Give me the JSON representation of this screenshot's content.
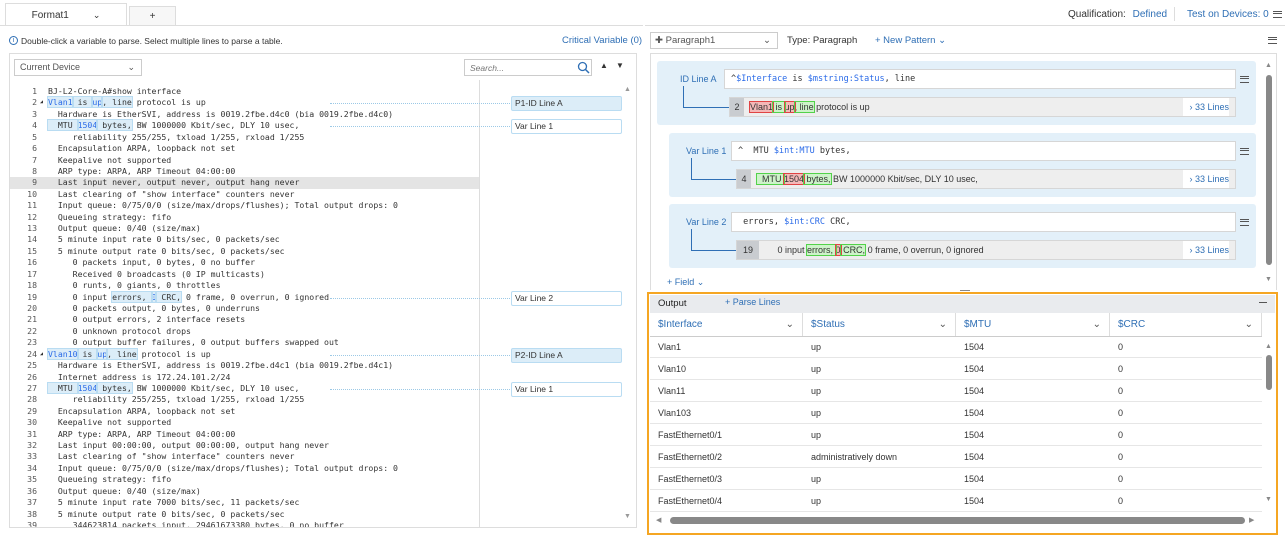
{
  "tabs": {
    "active": "Format1",
    "add": "+"
  },
  "header": {
    "qualification_label": "Qualification:",
    "qualification_value": "Defined",
    "test_devices": "Test on Devices: 0"
  },
  "left": {
    "hint": "Double-click a variable to parse. Select multiple lines to parse a table.",
    "critical": "Critical Variable (0)",
    "device_select": "Current Device",
    "search_placeholder": "Search...",
    "labels": [
      {
        "text": "P1-ID Line A",
        "line": 2,
        "id": true
      },
      {
        "text": "Var Line 1",
        "line": 4,
        "id": false
      },
      {
        "text": "Var Line 2",
        "line": 19,
        "id": false
      },
      {
        "text": "P2-ID Line A",
        "line": 24,
        "id": true
      },
      {
        "text": "Var Line 1",
        "line": 27,
        "id": false
      }
    ],
    "lines": [
      {
        "n": "1",
        "t": [
          [
            "BJ-L2-Core-A#show interface"
          ]
        ]
      },
      {
        "n": "2",
        "fold": true,
        "t": [
          [
            "Vlan1",
            "hv"
          ],
          [
            " is ",
            "h"
          ],
          [
            "up",
            "hv"
          ],
          [
            ", line",
            "h"
          ],
          [
            " protocol is up"
          ]
        ]
      },
      {
        "n": "3",
        "t": [
          [
            "  Hardware is EtherSVI, address is 0019.2fbe.d4c0 (bia 0019.2fbe.d4c0)"
          ]
        ]
      },
      {
        "n": "4",
        "t": [
          [
            "  MTU ",
            "h"
          ],
          [
            "1504",
            "hv"
          ],
          [
            " bytes,",
            "h"
          ],
          [
            " BW 1000000 Kbit/sec, DLY 10 usec,"
          ]
        ]
      },
      {
        "n": "5",
        "t": [
          [
            "     reliability 255/255, txload 1/255, rxload 1/255"
          ]
        ]
      },
      {
        "n": "6",
        "t": [
          [
            "  Encapsulation ARPA, loopback not set"
          ]
        ]
      },
      {
        "n": "7",
        "t": [
          [
            "  Keepalive not supported"
          ]
        ]
      },
      {
        "n": "8",
        "t": [
          [
            "  ARP type: ARPA, ARP Timeout 04:00:00"
          ]
        ]
      },
      {
        "n": "9",
        "sel": true,
        "t": [
          [
            "  Last input never, output never, output hang never"
          ]
        ]
      },
      {
        "n": "10",
        "t": [
          [
            "  Last clearing of \"show interface\" counters never"
          ]
        ]
      },
      {
        "n": "11",
        "t": [
          [
            "  Input queue: 0/75/0/0 (size/max/drops/flushes); Total output drops: 0"
          ]
        ]
      },
      {
        "n": "12",
        "t": [
          [
            "  Queueing strategy: fifo"
          ]
        ]
      },
      {
        "n": "13",
        "t": [
          [
            "  Output queue: 0/40 (size/max)"
          ]
        ]
      },
      {
        "n": "14",
        "t": [
          [
            "  5 minute input rate 0 bits/sec, 0 packets/sec"
          ]
        ]
      },
      {
        "n": "15",
        "t": [
          [
            "  5 minute output rate 0 bits/sec, 0 packets/sec"
          ]
        ]
      },
      {
        "n": "16",
        "t": [
          [
            "     0 packets input, 0 bytes, 0 no buffer"
          ]
        ]
      },
      {
        "n": "17",
        "t": [
          [
            "     Received 0 broadcasts (0 IP multicasts)"
          ]
        ]
      },
      {
        "n": "18",
        "t": [
          [
            "     0 runts, 0 giants, 0 throttles"
          ]
        ]
      },
      {
        "n": "19",
        "t": [
          [
            "     0 input "
          ],
          [
            "errors, ",
            "h"
          ],
          [
            "0",
            "hv"
          ],
          [
            " CRC,",
            "h"
          ],
          [
            " 0 frame, 0 overrun, 0 ignored"
          ]
        ]
      },
      {
        "n": "20",
        "t": [
          [
            "     0 packets output, 0 bytes, 0 underruns"
          ]
        ]
      },
      {
        "n": "21",
        "t": [
          [
            "     0 output errors, 2 interface resets"
          ]
        ]
      },
      {
        "n": "22",
        "t": [
          [
            "     0 unknown protocol drops"
          ]
        ]
      },
      {
        "n": "23",
        "t": [
          [
            "     0 output buffer failures, 0 output buffers swapped out"
          ]
        ]
      },
      {
        "n": "24",
        "fold": true,
        "t": [
          [
            "Vlan10",
            "hv"
          ],
          [
            " is ",
            "h"
          ],
          [
            "up",
            "hv"
          ],
          [
            ", line",
            "h"
          ],
          [
            " protocol is up"
          ]
        ]
      },
      {
        "n": "25",
        "t": [
          [
            "  Hardware is EtherSVI, address is 0019.2fbe.d4c1 (bia 0019.2fbe.d4c1)"
          ]
        ]
      },
      {
        "n": "26",
        "t": [
          [
            "  Internet address is 172.24.101.2/24"
          ]
        ]
      },
      {
        "n": "27",
        "t": [
          [
            "  MTU ",
            "h"
          ],
          [
            "1504",
            "hv"
          ],
          [
            " bytes,",
            "h"
          ],
          [
            " BW 1000000 Kbit/sec, DLY 10 usec,"
          ]
        ]
      },
      {
        "n": "28",
        "t": [
          [
            "     reliability 255/255, txload 1/255, rxload 1/255"
          ]
        ]
      },
      {
        "n": "29",
        "t": [
          [
            "  Encapsulation ARPA, loopback not set"
          ]
        ]
      },
      {
        "n": "30",
        "t": [
          [
            "  Keepalive not supported"
          ]
        ]
      },
      {
        "n": "31",
        "t": [
          [
            "  ARP type: ARPA, ARP Timeout 04:00:00"
          ]
        ]
      },
      {
        "n": "32",
        "t": [
          [
            "  Last input 00:00:00, output 00:00:00, output hang never"
          ]
        ]
      },
      {
        "n": "33",
        "t": [
          [
            "  Last clearing of \"show interface\" counters never"
          ]
        ]
      },
      {
        "n": "34",
        "t": [
          [
            "  Input queue: 0/75/0/0 (size/max/drops/flushes); Total output drops: 0"
          ]
        ]
      },
      {
        "n": "35",
        "t": [
          [
            "  Queueing strategy: fifo"
          ]
        ]
      },
      {
        "n": "36",
        "t": [
          [
            "  Output queue: 0/40 (size/max)"
          ]
        ]
      },
      {
        "n": "37",
        "t": [
          [
            "  5 minute input rate 7000 bits/sec, 11 packets/sec"
          ]
        ]
      },
      {
        "n": "38",
        "t": [
          [
            "  5 minute output rate 0 bits/sec, 0 packets/sec"
          ]
        ]
      },
      {
        "n": "39",
        "t": [
          [
            "     344623814 packets input, 29461673380 bytes, 0 no buffer"
          ]
        ]
      }
    ]
  },
  "right": {
    "paragraph_select": "Paragraph1",
    "type": "Type: Paragraph",
    "new_pattern": "+ New Pattern",
    "add_field": "+ Field",
    "patterns": [
      {
        "label": "ID Line A",
        "pattern": [
          [
            "^"
          ],
          [
            "$Interface",
            "v"
          ],
          [
            " is "
          ],
          [
            "$mstring:Status",
            "v"
          ],
          [
            ", line"
          ]
        ],
        "line": "2",
        "sample": [
          [
            "Vlan1",
            "r"
          ],
          [
            " is ",
            "g"
          ],
          [
            "up",
            "r"
          ],
          [
            ", line",
            "g"
          ],
          [
            " protocol is up"
          ]
        ],
        "more": "33 Lines"
      },
      {
        "label": "Var Line 1",
        "pattern": [
          [
            "^  MTU "
          ],
          [
            "$int:MTU",
            "v"
          ],
          [
            " bytes,"
          ]
        ],
        "line": "4",
        "sample": [
          [
            "  MTU ",
            "g"
          ],
          [
            "1504",
            "r"
          ],
          [
            " bytes,",
            "g"
          ],
          [
            " BW 1000000 Kbit/sec, DLY 10 usec,"
          ]
        ],
        "more": "33 Lines"
      },
      {
        "label": "Var Line 2",
        "pattern": [
          [
            " errors, "
          ],
          [
            "$int:CRC",
            "v"
          ],
          [
            " CRC,"
          ]
        ],
        "line": "19",
        "sample": [
          [
            "     0 input "
          ],
          [
            "errors, ",
            "g"
          ],
          [
            "0",
            "r"
          ],
          [
            " CRC,",
            "g"
          ],
          [
            " 0 frame, 0 overrun, 0 ignored"
          ]
        ],
        "more": "33 Lines"
      }
    ],
    "output": {
      "title": "Output",
      "parse_lines": "+ Parse Lines",
      "columns": [
        "$Interface",
        "$Status",
        "$MTU",
        "$CRC"
      ],
      "rows": [
        [
          "Vlan1",
          "up",
          "1504",
          "0"
        ],
        [
          "Vlan10",
          "up",
          "1504",
          "0"
        ],
        [
          "Vlan11",
          "up",
          "1504",
          "0"
        ],
        [
          "Vlan103",
          "up",
          "1504",
          "0"
        ],
        [
          "FastEthernet0/1",
          "up",
          "1504",
          "0"
        ],
        [
          "FastEthernet0/2",
          "administratively down",
          "1504",
          "0"
        ],
        [
          "FastEthernet0/3",
          "up",
          "1504",
          "0"
        ],
        [
          "FastEthernet0/4",
          "up",
          "1504",
          "0"
        ]
      ]
    }
  },
  "colors": {
    "accent": "#2f6fb5",
    "highlight_border": "#f5a623",
    "var_blue": "#2b6be8",
    "match_green": "#53d24a",
    "match_red": "#e04444"
  }
}
